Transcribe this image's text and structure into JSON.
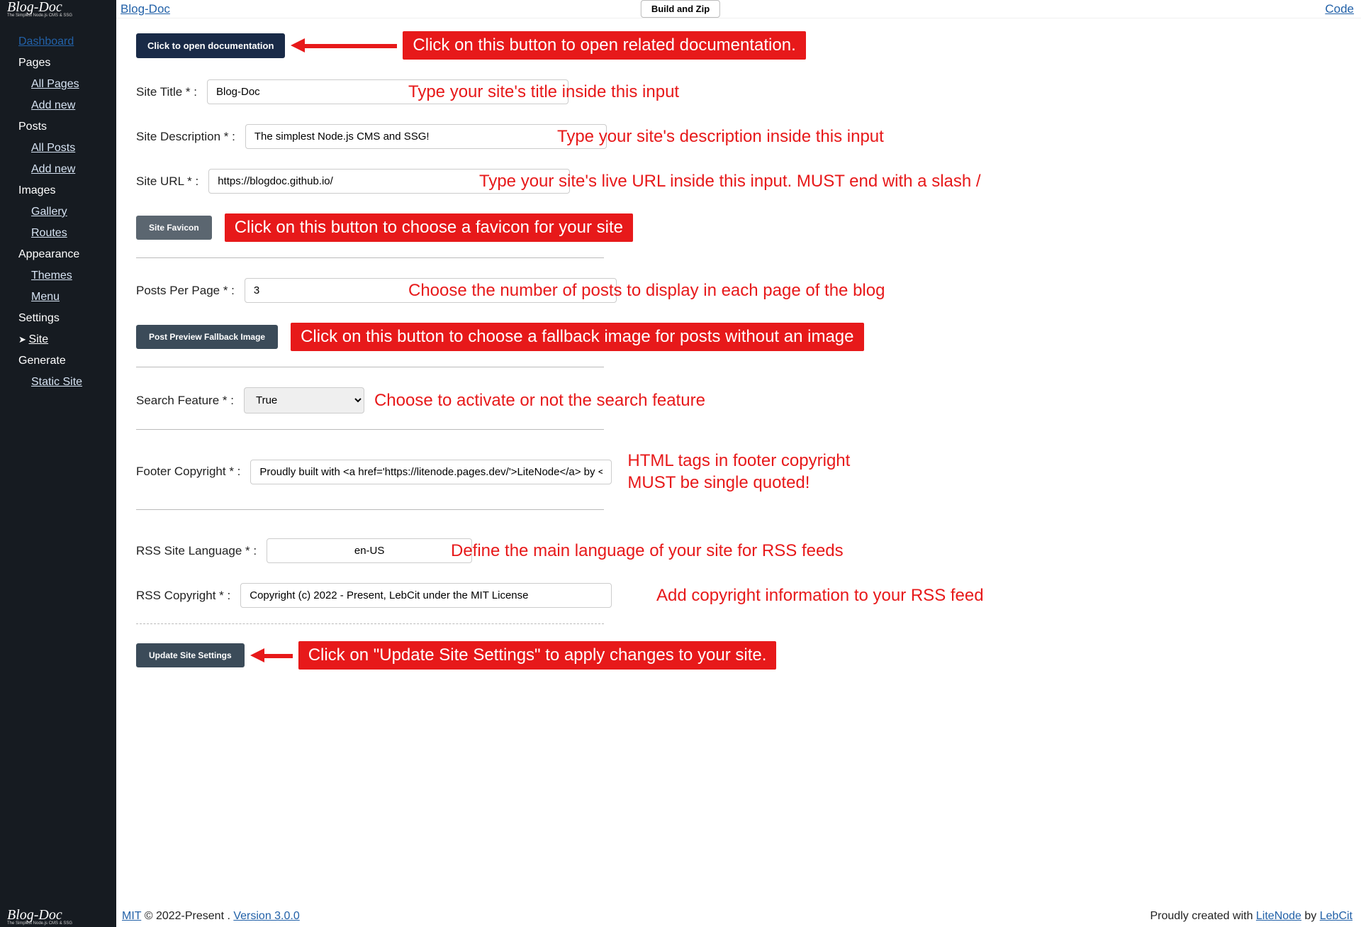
{
  "topbar": {
    "site_link": "Blog-Doc",
    "build_btn": "Build and Zip",
    "code_link": "Code",
    "brand_title": "Blog-Doc",
    "brand_sub": "The Simplest Node.js CMS & SSG"
  },
  "sidebar": {
    "dashboard": "Dashboard",
    "pages": "Pages",
    "all_pages": "All Pages",
    "pages_add": "Add new",
    "posts": "Posts",
    "all_posts": "All Posts",
    "posts_add": "Add new",
    "images": "Images",
    "gallery": "Gallery",
    "routes": "Routes",
    "appearance": "Appearance",
    "themes": "Themes",
    "menu": "Menu",
    "settings": "Settings",
    "site": "Site",
    "generate": "Generate",
    "static_site": "Static Site"
  },
  "main": {
    "open_doc_btn": "Click to open documentation",
    "site_title_label": "Site Title * :",
    "site_title_value": "Blog-Doc",
    "site_desc_label": "Site Description * :",
    "site_desc_value": "The simplest Node.js CMS and SSG!",
    "site_url_label": "Site URL * :",
    "site_url_value": "https://blogdoc.github.io/",
    "favicon_btn": "Site Favicon",
    "posts_per_page_label": "Posts Per Page * :",
    "posts_per_page_value": "3",
    "fallback_btn": "Post Preview Fallback Image",
    "search_label": "Search Feature * :",
    "search_value": "True",
    "footer_copy_label": "Footer Copyright * :",
    "footer_copy_value": "Proudly built with <a href='https://litenode.pages.dev/'>LiteNode</a> by <a",
    "rss_lang_label": "RSS Site Language * :",
    "rss_lang_value": "en-US",
    "rss_copy_label": "RSS Copyright * :",
    "rss_copy_value": "Copyright (c) 2022 - Present, LebCit under the MIT License",
    "update_btn": "Update Site Settings"
  },
  "annotations": {
    "open_doc": "Click on this button to open related documentation.",
    "site_title": "Type your site's title inside this input",
    "site_desc": "Type your site's description inside this input",
    "site_url": "Type your site's live URL inside this input. MUST end with a slash /",
    "favicon": "Click on this button to choose a favicon for your site",
    "ppp": "Choose the number of posts to display in each page of the blog",
    "fallback": "Click on this button to choose a fallback image for posts without an image",
    "search": "Choose to activate or not the search feature",
    "footer": "HTML tags in footer copyright MUST be single quoted!",
    "rss_lang": "Define the main language of your site for RSS feeds",
    "rss_copy": "Add copyright information to your RSS feed",
    "update": "Click on \"Update Site Settings\" to apply changes to your site."
  },
  "footer": {
    "mit": "MIT",
    "copyright": " © 2022-Present . ",
    "version": "Version 3.0.0",
    "credit_prefix": "Proudly created with ",
    "litenode": "LiteNode",
    "by": " by ",
    "lebcit": "LebCit"
  }
}
